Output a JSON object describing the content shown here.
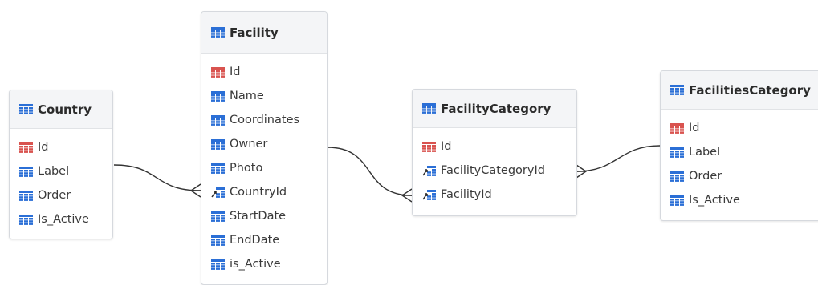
{
  "colors": {
    "table_icon": "#2b6fd6",
    "primary_key_icon": "#d9534f",
    "foreign_key_arrow": "#2b2b2b",
    "connector_line": "#333333"
  },
  "tables": {
    "country": {
      "title": "Country",
      "icon": "table-icon",
      "fields": [
        {
          "name": "Id",
          "icon": "primary-key-icon"
        },
        {
          "name": "Label",
          "icon": "column-icon"
        },
        {
          "name": "Order",
          "icon": "column-icon"
        },
        {
          "name": "Is_Active",
          "icon": "column-icon"
        }
      ]
    },
    "facility": {
      "title": "Facility",
      "icon": "table-icon",
      "fields": [
        {
          "name": "Id",
          "icon": "primary-key-icon"
        },
        {
          "name": "Name",
          "icon": "column-icon"
        },
        {
          "name": "Coordinates",
          "icon": "column-icon"
        },
        {
          "name": "Owner",
          "icon": "column-icon"
        },
        {
          "name": "Photo",
          "icon": "column-icon"
        },
        {
          "name": "CountryId",
          "icon": "foreign-key-icon"
        },
        {
          "name": "StartDate",
          "icon": "column-icon"
        },
        {
          "name": "EndDate",
          "icon": "column-icon"
        },
        {
          "name": "is_Active",
          "icon": "column-icon"
        }
      ]
    },
    "facility_category": {
      "title": "FacilityCategory",
      "icon": "table-icon",
      "fields": [
        {
          "name": "Id",
          "icon": "primary-key-icon"
        },
        {
          "name": "FacilityCategoryId",
          "icon": "foreign-key-icon"
        },
        {
          "name": "FacilityId",
          "icon": "foreign-key-icon"
        }
      ]
    },
    "facilities_category": {
      "title": "FacilitiesCategory",
      "icon": "table-icon",
      "fields": [
        {
          "name": "Id",
          "icon": "primary-key-icon"
        },
        {
          "name": "Label",
          "icon": "column-icon"
        },
        {
          "name": "Order",
          "icon": "column-icon"
        },
        {
          "name": "Is_Active",
          "icon": "column-icon"
        }
      ]
    }
  },
  "relationships": [
    {
      "from": "Country.Id",
      "to": "Facility.CountryId",
      "cardinality": "one-to-many"
    },
    {
      "from": "Facility.Id",
      "to": "FacilityCategory.FacilityId",
      "cardinality": "one-to-many"
    },
    {
      "from": "FacilitiesCategory.Id",
      "to": "FacilityCategory.FacilityCategoryId",
      "cardinality": "one-to-many"
    }
  ]
}
